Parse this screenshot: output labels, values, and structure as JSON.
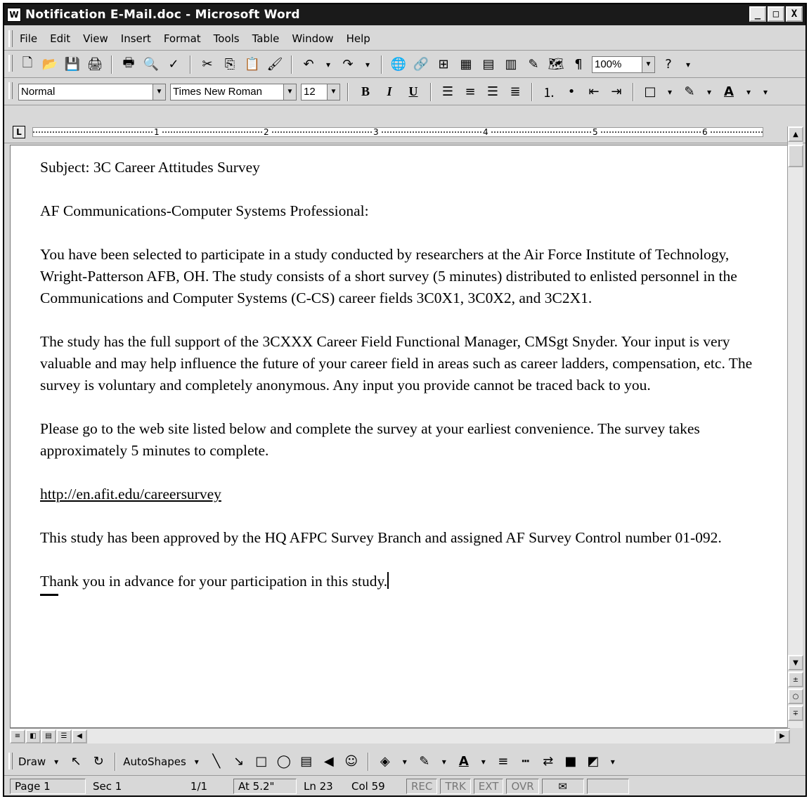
{
  "window": {
    "title": "Notification E-Mail.doc - Microsoft Word",
    "icon": "word-doc-icon",
    "controls": [
      "_",
      "□",
      "X"
    ]
  },
  "menu": [
    "File",
    "Edit",
    "View",
    "Insert",
    "Format",
    "Tools",
    "Table",
    "Window",
    "Help"
  ],
  "standard_toolbar": {
    "zoom": "100%"
  },
  "formatting_toolbar": {
    "style": "Normal",
    "font": "Times New Roman",
    "size": "12",
    "bold": "B",
    "italic": "I",
    "underline": "U"
  },
  "ruler": {
    "marks": [
      "1",
      "2",
      "3",
      "4",
      "5",
      "6"
    ]
  },
  "document": {
    "paragraphs": [
      "Subject:  3C Career Attitudes Survey",
      "AF Communications-Computer Systems Professional:",
      "You have been selected to participate in a study conducted by researchers at the Air Force Institute of Technology, Wright-Patterson AFB, OH.  The study consists of a short survey (5 minutes) distributed to enlisted personnel in the Communications and Computer Systems (C-CS) career fields 3C0X1, 3C0X2, and 3C2X1.",
      "The study has the full support of the 3CXXX Career Field Functional Manager, CMSgt Snyder.  Your input is very valuable and may help influence the future of your career field in areas such as career ladders, compensation, etc.  The survey is voluntary and completely anonymous.  Any input you provide cannot be traced back to you.",
      "Please go to the web site listed below and complete the survey at your earliest convenience.  The survey takes approximately 5 minutes to complete.",
      "http://en.afit.edu/careersurvey",
      "This study has been approved by the HQ AFPC Survey Branch and assigned AF Survey Control number 01-092.",
      "Thank you in advance for your participation in this study."
    ]
  },
  "drawing_toolbar": {
    "draw_label": "Draw",
    "autoshapes_label": "AutoShapes"
  },
  "status_bar": {
    "page": "Page 1",
    "section": "Sec 1",
    "pages": "1/1",
    "at": "At 5.2\"",
    "line": "Ln 23",
    "col": "Col 59",
    "rec": "REC",
    "trk": "TRK",
    "ext": "EXT",
    "ovr": "OVR"
  }
}
